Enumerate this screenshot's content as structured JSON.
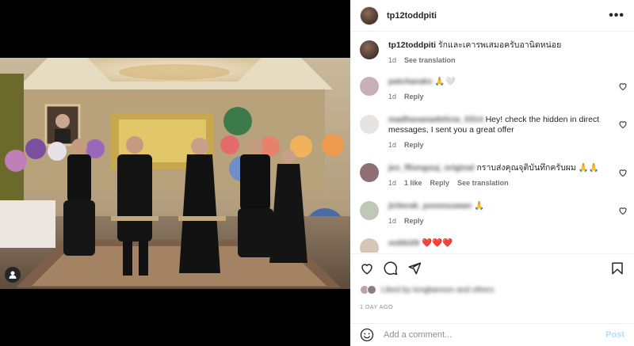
{
  "header": {
    "username": "tp12toddpiti",
    "more_label": "•••"
  },
  "caption": {
    "username": "tp12toddpiti",
    "text": "รักและเคารพเสมอครับอานิดหน่อย",
    "time": "1d",
    "translate": "See translation"
  },
  "comments": [
    {
      "username": "patcharaks",
      "text": "🙏🤍",
      "time": "1d",
      "reply": "Reply"
    },
    {
      "username": "madhavanadelicia_0314",
      "text": "Hey! check the hidden in direct messages, I sent you a great offer",
      "time": "1d",
      "reply": "Reply"
    },
    {
      "username": "jes_ffiongsuj_original",
      "text": "กราบส่งคุณจุติบันทึกครับผม 🙏🙏",
      "time": "1d",
      "likes": "1 like",
      "reply": "Reply",
      "translate": "See translation"
    },
    {
      "username": "jiriterak_poomsuwan",
      "text": "🙏",
      "time": "1d",
      "reply": "Reply"
    },
    {
      "username": "nokki29",
      "text": "❤️❤️❤️",
      "time": "",
      "reply": ""
    }
  ],
  "likes": {
    "text": "Liked by tongbanson and others"
  },
  "date": "1 DAY AGO",
  "add_comment": {
    "placeholder": "Add a comment...",
    "post_label": "Post"
  },
  "colors": {
    "link": "#0095f6",
    "post_disabled": "#b2dffc",
    "muted": "#737373"
  }
}
